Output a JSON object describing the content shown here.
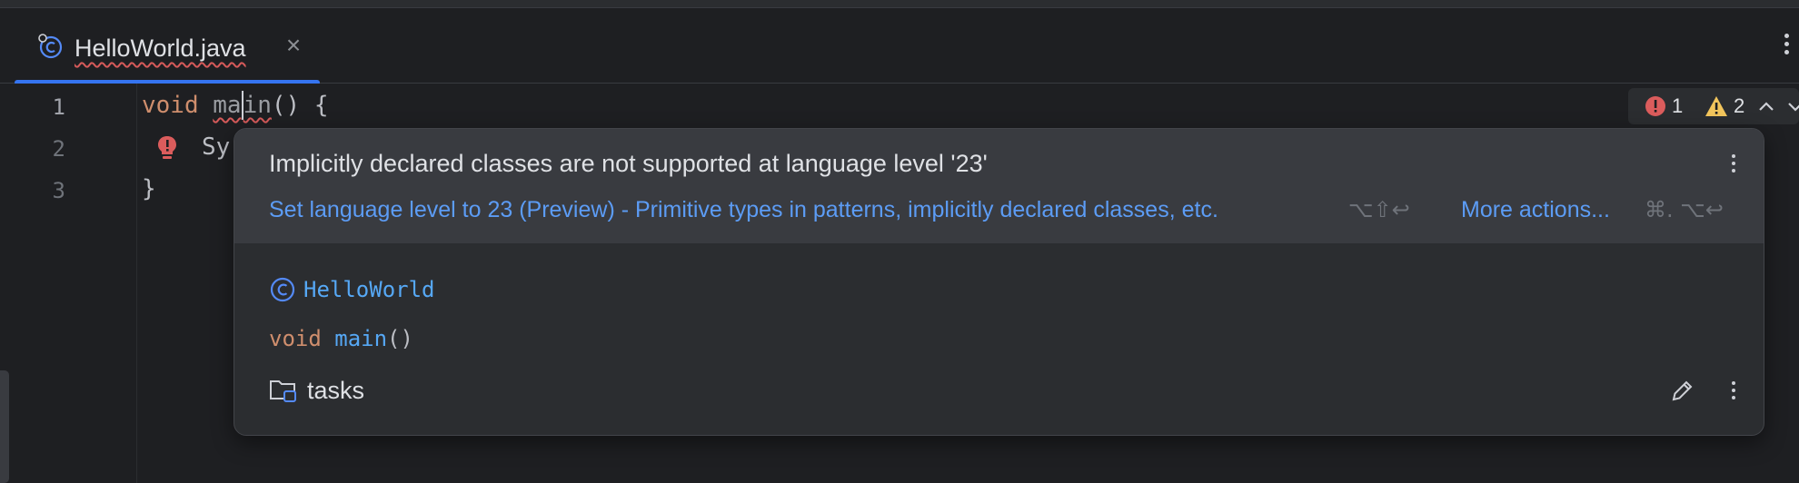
{
  "tab": {
    "label": "HelloWorld.java",
    "icon": "java-class-icon",
    "close_symbol": "×"
  },
  "editor": {
    "line_numbers": [
      "1",
      "2",
      "3"
    ],
    "line1": {
      "keyword": "void",
      "method_start": "ma",
      "method_end": "in",
      "rest": "() {"
    },
    "line2": {
      "text": "Sy"
    },
    "line3": {
      "text": "}"
    }
  },
  "inspection": {
    "errors": "1",
    "warnings": "2",
    "error_color": "#db5c5c",
    "warning_color": "#f2c55c"
  },
  "popup": {
    "title": "Implicitly declared classes are not supported at language level '23'",
    "fix_label": "Set language level to 23 (Preview) - Primitive types in patterns, implicitly declared classes, etc.",
    "fix_shortcut": "⌥⇧↩",
    "more_actions_label": "More actions...",
    "more_actions_shortcut": "⌘. ⌥↩",
    "class_name": "HelloWorld",
    "method_keyword": "void",
    "method_name": "main",
    "method_parens": "()",
    "module_name": "tasks"
  },
  "colors": {
    "accent": "#3574f0",
    "link": "#5c9cf5",
    "keyword": "#cf8e6d",
    "function": "#56a8f5"
  }
}
